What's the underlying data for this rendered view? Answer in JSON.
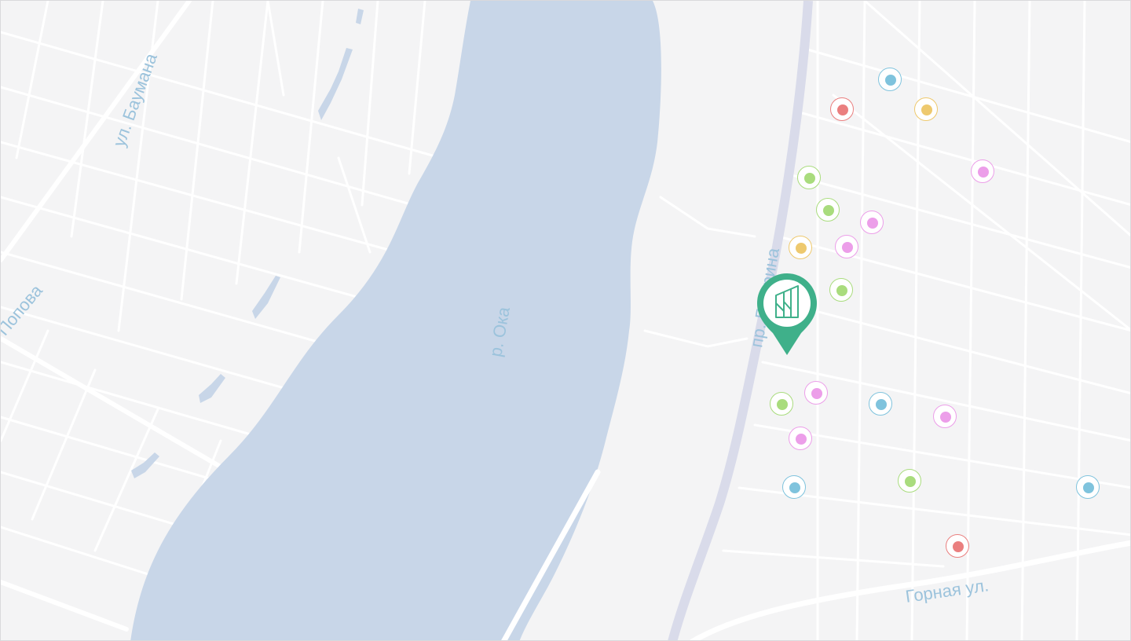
{
  "map": {
    "colors": {
      "land": "#f4f4f5",
      "road": "#ffffff",
      "water": "#c8d6e8",
      "highway": "#d9dbea",
      "label": "#9cc3dc",
      "pin": "#3fb08a"
    },
    "labels": {
      "bauman": "ул. Баумана",
      "popov": "Попова",
      "oka": "р. Ока",
      "gagarin": "пр. Гагарина",
      "gornaya": "Горная ул."
    },
    "main_marker": {
      "icon": "building-logo-icon",
      "color": "#3fb08a"
    },
    "poi_categories": {
      "red": {
        "color": "#ea7f7f"
      },
      "yellow": {
        "color": "#eec96e"
      },
      "green": {
        "color": "#a9dc7d"
      },
      "pink": {
        "color": "#ec9ee9"
      },
      "blue": {
        "color": "#7fc3dd"
      }
    }
  }
}
